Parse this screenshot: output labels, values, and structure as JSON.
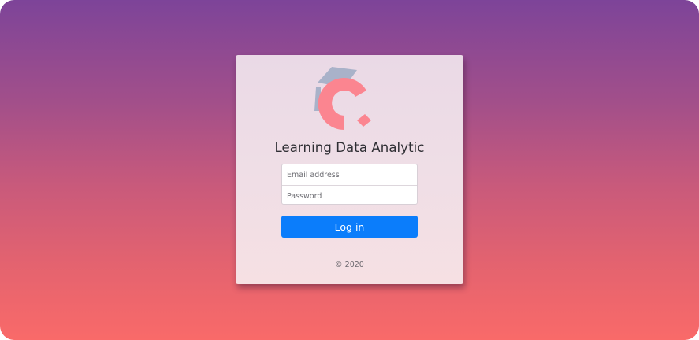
{
  "app": {
    "title": "Learning Data Analytic",
    "logo_icon": "graduation-cap-c-logo-icon"
  },
  "form": {
    "email_placeholder": "Email address",
    "email_value": "",
    "password_placeholder": "Password",
    "password_value": "",
    "submit_label": "Log in"
  },
  "footer": {
    "copyright": "© 2020"
  },
  "colors": {
    "accent": "#0b7dfb",
    "logo_cap": "#a9b2c9",
    "logo_c": "#fb8590",
    "gradient_top": "#7d4499",
    "gradient_bottom": "#f96a69"
  }
}
